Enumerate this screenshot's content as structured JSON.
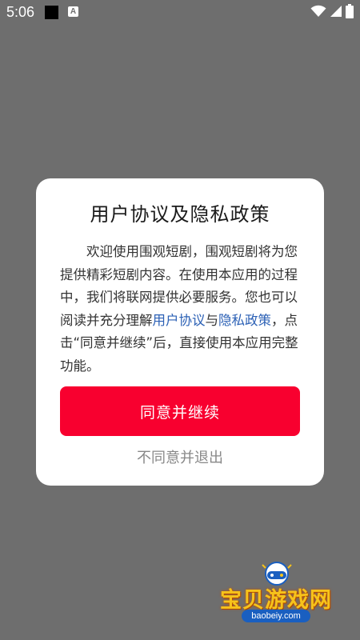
{
  "status_bar": {
    "time": "5:06",
    "notification_icon_letter": "A",
    "icons": [
      "wifi-icon",
      "cell-signal-icon",
      "battery-icon"
    ]
  },
  "dialog": {
    "title": "用户协议及隐私政策",
    "body_part1": "欢迎使用围观短剧，围观短剧将为您提供精彩短剧内容。在使用本应用的过程中，我们将联网提供必要服务。您也可以阅读并充分理解",
    "user_agreement_link": "用户协议",
    "connector": "与",
    "privacy_policy_link": "隐私政策",
    "body_part2": "，点击“同意并继续”后，直接使用本应用完整功能。",
    "agree_button": "同意并继续",
    "exit_button": "不同意并退出",
    "link_color": "#2b60b5",
    "accent_color": "#f8002f"
  },
  "watermark": {
    "text": "宝贝游戏网",
    "url": "baobeiy.com"
  }
}
